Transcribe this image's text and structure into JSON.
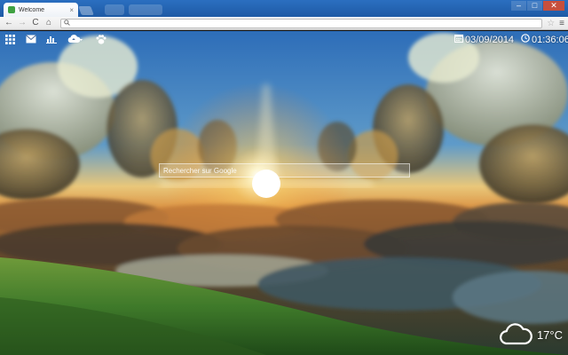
{
  "browser": {
    "tab_title": "Welcome",
    "tab_close": "×",
    "window_controls": {
      "minimize": "–",
      "maximize": "□",
      "close": "✕"
    },
    "toolbar": {
      "back": "←",
      "forward": "→",
      "reload": "C",
      "home": "⌂",
      "url_value": "",
      "search_icon": "search-icon",
      "star": "☆",
      "menu": "≡"
    }
  },
  "topbar": {
    "icons": [
      "apps-grid-icon",
      "mail-icon",
      "bar-chart-icon",
      "cloud-upload-icon",
      "paw-icon"
    ],
    "date": "03/09/2014",
    "time": "01:36:06"
  },
  "search": {
    "placeholder": "Rechercher sur Google"
  },
  "weather": {
    "icon": "cloud-icon",
    "temperature": "17°C"
  },
  "colors": {
    "sky_top": "#2d6db8",
    "sun": "#fff4c2",
    "grass": "#3f7a2a"
  }
}
